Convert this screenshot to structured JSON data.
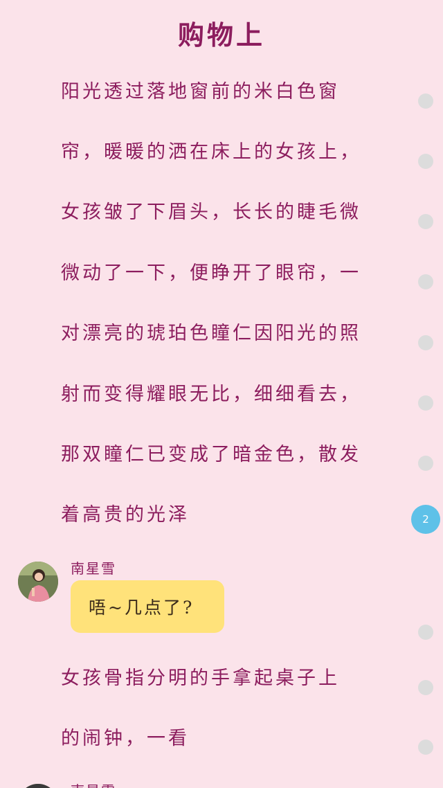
{
  "title": "购物上",
  "paragraph1": [
    "阳光透过落地窗前的米白色窗",
    "帘，暖暖的洒在床上的女孩上，",
    "女孩皱了下眉头，长长的睫毛微",
    "微动了一下，便睁开了眼帘，一",
    "对漂亮的琥珀色瞳仁因阳光的照",
    "射而变得耀眼无比，细细看去，",
    "那双瞳仁已变成了暗金色，散发",
    "着高贵的光泽"
  ],
  "comment_count": "2",
  "message": {
    "speaker": "南星雪",
    "text": "唔~几点了?"
  },
  "paragraph2": [
    "女孩骨指分明的手拿起桌子上",
    "的闹钟，一看"
  ],
  "next_speaker": "南星雪",
  "colors": {
    "background": "#fbe3ea",
    "text": "#8c1d5e",
    "bubble": "#ffe27a",
    "badge": "#5ec1e8"
  }
}
